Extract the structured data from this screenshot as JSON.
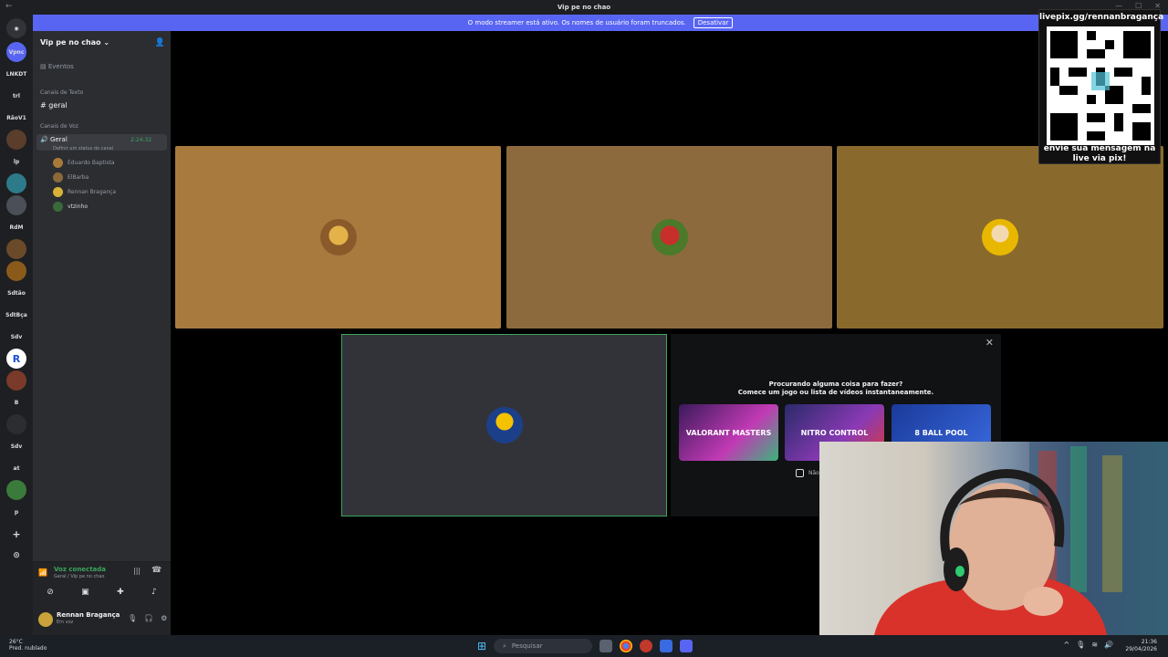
{
  "window": {
    "title": "Vip pe no chao"
  },
  "streamer_banner": {
    "text": "O modo streamer está ativo. Os nomes de usuário foram truncados.",
    "button": "Desativar"
  },
  "guilds": [
    {
      "label": "Vpnc",
      "top": 0
    },
    {
      "label": "LNKDT"
    },
    {
      "label": "trl"
    },
    {
      "label": "RãoV1"
    },
    {
      "label": "lp"
    },
    {
      "label": "RdM"
    },
    {
      "label": "Sdtão"
    },
    {
      "label": "SdtBça"
    },
    {
      "label": "Sdv"
    },
    {
      "label": "B"
    },
    {
      "label": "Sdv"
    },
    {
      "label": "at"
    },
    {
      "label": "p"
    }
  ],
  "sidebar": {
    "server_name": "Vip pe no chao",
    "events": "Eventos",
    "text_category": "Canais de Texto",
    "text_channel": "geral",
    "voice_category": "Canais de Voz",
    "voice_channel": "Geral",
    "voice_timer": "2:24:32",
    "status_hint": "Definir um status do canal",
    "members": [
      "Eduardo Baptista",
      "ElBarba",
      "Rennan Bragança",
      "vtzinho"
    ]
  },
  "voice_panel": {
    "status": "Voz conectada",
    "location": "Geral / Vip pe no chao"
  },
  "user_panel": {
    "name": "Rennan Bragança",
    "status": "Em voz"
  },
  "activity": {
    "line1": "Procurando alguma coisa para fazer?",
    "line2": "Comece um jogo ou lista de vídeos instantaneamente.",
    "games": [
      "VALORANT MASTERS",
      "NITRO CONTROL",
      "8 BALL POOL"
    ],
    "checkbox_label": "Não"
  },
  "overlay": {
    "url": "livepix.gg/rennanbragança",
    "message_line1": "envie sua mensagem na",
    "message_line2": "live via pix!"
  },
  "taskbar": {
    "weather_temp": "26°C",
    "weather_desc": "Pred. nublado",
    "search_placeholder": "Pesquisar",
    "time": "21:36",
    "date": "29/04/2026"
  },
  "colors": {
    "accent": "#5865f2",
    "voice_green": "#3ba55c",
    "tile_1": "#a97a3e",
    "tile_2": "#8d6a3e",
    "tile_3": "#8a6a2c"
  }
}
